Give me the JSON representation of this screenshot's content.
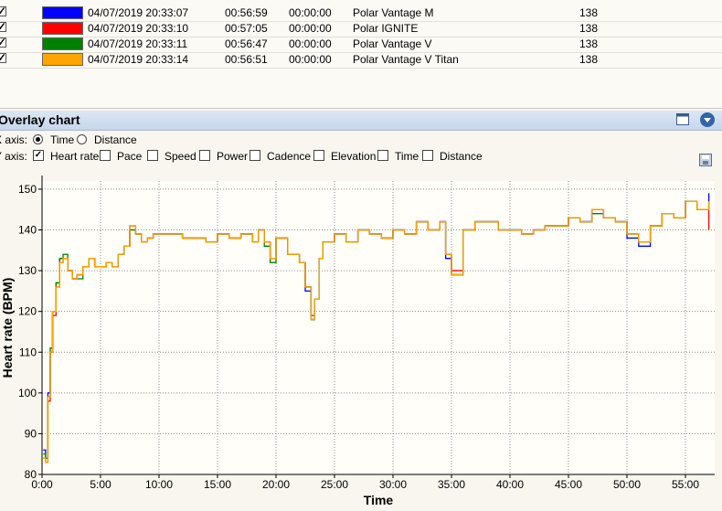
{
  "sessions": [
    {
      "checked": true,
      "color": "#0000ff",
      "start": "04/07/2019 20:33:07",
      "duration": "00:56:59",
      "offset": "00:00:00",
      "device": "Polar Vantage M",
      "value": "138"
    },
    {
      "checked": true,
      "color": "#ff0000",
      "start": "04/07/2019 20:33:10",
      "duration": "00:57:05",
      "offset": "00:00:00",
      "device": "Polar IGNITE",
      "value": "138"
    },
    {
      "checked": true,
      "color": "#008000",
      "start": "04/07/2019 20:33:11",
      "duration": "00:56:47",
      "offset": "00:00:00",
      "device": "Polar Vantage V",
      "value": "138"
    },
    {
      "checked": true,
      "color": "#ffa500",
      "start": "04/07/2019 20:33:14",
      "duration": "00:56:51",
      "offset": "00:00:00",
      "device": "Polar Vantage V Titan",
      "value": "138"
    }
  ],
  "panel": {
    "title": "Overlay chart",
    "maximize_icon": "window-icon",
    "collapse_icon": "chevron-down-circle-icon",
    "save_icon": "save-icon"
  },
  "x_axis": {
    "label": "X axis:",
    "options": [
      {
        "label": "Time",
        "selected": true
      },
      {
        "label": "Distance",
        "selected": false
      }
    ]
  },
  "y_axis": {
    "label": "Y axis:",
    "options": [
      {
        "label": "Heart rate",
        "checked": true
      },
      {
        "label": "Pace",
        "checked": false
      },
      {
        "label": "Speed",
        "checked": false
      },
      {
        "label": "Power",
        "checked": false
      },
      {
        "label": "Cadence",
        "checked": false
      },
      {
        "label": "Elevation",
        "checked": false
      },
      {
        "label": "Time",
        "checked": false
      },
      {
        "label": "Distance",
        "checked": false
      }
    ]
  },
  "chart_data": {
    "type": "line",
    "xlabel": "Time",
    "ylabel": "Heart rate (BPM)",
    "xlim": [
      0,
      57.5
    ],
    "ylim": [
      80,
      152
    ],
    "x_ticks": [
      "0:00",
      "5:00",
      "10:00",
      "15:00",
      "20:00",
      "25:00",
      "30:00",
      "35:00",
      "40:00",
      "45:00",
      "50:00",
      "55:00"
    ],
    "x_tick_values": [
      0,
      5,
      10,
      15,
      20,
      25,
      30,
      35,
      40,
      45,
      50,
      55
    ],
    "y_ticks": [
      80,
      90,
      100,
      110,
      120,
      130,
      140,
      150
    ],
    "grid": true,
    "series_colors": [
      "#0000ff",
      "#ff0000",
      "#008000",
      "#ffa500"
    ],
    "x": [
      0.1,
      0.3,
      0.5,
      0.7,
      0.9,
      1.2,
      1.5,
      1.8,
      2.2,
      2.6,
      3.0,
      3.5,
      4.0,
      4.5,
      5.0,
      5.5,
      6.0,
      6.5,
      7.0,
      7.5,
      8.0,
      8.5,
      9.0,
      9.5,
      10.0,
      11.0,
      12.0,
      13.0,
      14.0,
      15.0,
      16.0,
      17.0,
      18.0,
      18.5,
      19.0,
      19.5,
      20.0,
      21.0,
      22.0,
      22.5,
      23.0,
      23.3,
      23.7,
      24.0,
      25.0,
      26.0,
      27.0,
      28.0,
      29.0,
      30.0,
      31.0,
      32.0,
      33.0,
      34.0,
      34.5,
      35.0,
      36.0,
      37.0,
      38.0,
      39.0,
      40.0,
      41.0,
      42.0,
      43.0,
      44.0,
      45.0,
      46.0,
      47.0,
      48.0,
      49.0,
      50.0,
      51.0,
      52.0,
      53.0,
      54.0,
      55.0,
      56.0,
      57.0
    ],
    "series": [
      {
        "values": [
          86,
          84,
          100,
          110,
          120,
          127,
          133,
          133,
          130,
          128,
          129,
          131,
          133,
          131,
          131,
          132,
          131,
          134,
          136,
          141,
          139,
          137,
          138,
          139,
          139,
          139,
          138,
          138,
          137,
          139,
          138,
          139,
          137,
          140,
          137,
          133,
          138,
          134,
          132,
          125,
          118,
          123,
          133,
          137,
          139,
          137,
          140,
          139,
          138,
          140,
          139,
          142,
          140,
          142,
          133,
          129,
          140,
          142,
          142,
          140,
          140,
          139,
          140,
          141,
          141,
          143,
          142,
          145,
          143,
          142,
          138,
          136,
          141,
          144,
          143,
          147,
          145,
          149
        ]
      },
      {
        "values": [
          84,
          83,
          98,
          110,
          119,
          126,
          132,
          133,
          130,
          128,
          129,
          131,
          133,
          131,
          131,
          132,
          131,
          134,
          136,
          140,
          139,
          137,
          138,
          139,
          139,
          139,
          138,
          138,
          137,
          139,
          138,
          139,
          137,
          140,
          137,
          133,
          138,
          134,
          132,
          126,
          119,
          123,
          133,
          137,
          139,
          137,
          140,
          139,
          138,
          140,
          139,
          142,
          140,
          142,
          134,
          130,
          140,
          142,
          142,
          140,
          140,
          139,
          140,
          141,
          141,
          143,
          142,
          145,
          143,
          142,
          139,
          137,
          141,
          144,
          143,
          147,
          145,
          140
        ]
      },
      {
        "values": [
          85,
          84,
          99,
          111,
          120,
          127,
          133,
          134,
          130,
          128,
          128,
          131,
          133,
          131,
          131,
          132,
          131,
          134,
          136,
          140,
          139,
          137,
          138,
          139,
          139,
          139,
          138,
          138,
          137,
          139,
          138,
          139,
          137,
          140,
          136,
          132,
          138,
          134,
          132,
          126,
          118,
          123,
          133,
          137,
          139,
          137,
          140,
          139,
          138,
          140,
          139,
          142,
          140,
          142,
          134,
          129,
          140,
          142,
          142,
          140,
          140,
          139,
          140,
          141,
          141,
          143,
          142,
          144,
          143,
          142,
          139,
          137,
          141,
          144,
          143,
          147,
          145,
          146
        ]
      },
      {
        "values": [
          84,
          83,
          99,
          110,
          120,
          126,
          132,
          133,
          130,
          128,
          129,
          131,
          133,
          131,
          131,
          132,
          131,
          134,
          136,
          141,
          139,
          137,
          138,
          139,
          139,
          139,
          138,
          138,
          137,
          139,
          138,
          139,
          137,
          140,
          137,
          133,
          138,
          134,
          132,
          126,
          118,
          123,
          133,
          137,
          139,
          137,
          140,
          139,
          138,
          140,
          139,
          142,
          140,
          142,
          134,
          129,
          140,
          142,
          142,
          140,
          140,
          139,
          140,
          141,
          141,
          143,
          142,
          145,
          143,
          142,
          139,
          137,
          141,
          144,
          143,
          147,
          145,
          147
        ]
      }
    ]
  }
}
